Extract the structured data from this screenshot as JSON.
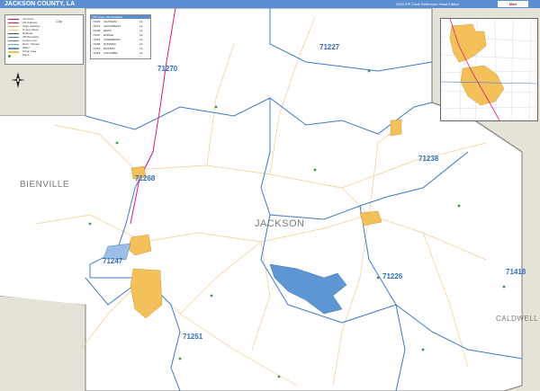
{
  "header": {
    "title": "JACKSON COUNTY, LA",
    "subtitle": "2020 ZIP Code Reference Head Edition",
    "brand": "Mart"
  },
  "counties": {
    "center": "JACKSON",
    "west": "BIENVILLE",
    "southeast": "CALDWELL"
  },
  "zips": {
    "z71227": "71227",
    "z71270": "71270",
    "z71238": "71238",
    "z71268": "71268",
    "z71247": "71247",
    "z71226": "71226",
    "z71251": "71251",
    "z71418": "71418"
  },
  "legend": {
    "items": [
      "Interstate",
      "US Highway",
      "State Highway",
      "County Road",
      "Railroad",
      "ZIP Boundary",
      "County Line",
      "River / Stream",
      "Water",
      "Urban Area",
      "Place"
    ],
    "city_label": "City"
  },
  "zip_table": {
    "header": "ZIP Code / Municipalities",
    "rows": [
      {
        "zip": "71226",
        "name": "CHATHAM",
        "county": "LA"
      },
      {
        "zip": "71227",
        "name": "CHOUDRANT",
        "county": "LA"
      },
      {
        "zip": "71238",
        "name": "EROS",
        "county": "LA"
      },
      {
        "zip": "71247",
        "name": "HODGE",
        "county": "LA"
      },
      {
        "zip": "71251",
        "name": "JONESBORO",
        "county": "LA"
      },
      {
        "zip": "71268",
        "name": "QUITMAN",
        "county": "LA"
      },
      {
        "zip": "71270",
        "name": "RUSTON",
        "county": "LA"
      },
      {
        "zip": "71418",
        "name": "COLUMBIA",
        "county": "LA"
      }
    ]
  },
  "colors": {
    "title_bar": "#5b8fd1",
    "zip_boundary": "#3e79c8",
    "county_fill": "#ffffff",
    "outside_fill": "#e5e2d8",
    "urban": "#f4c059",
    "water": "#5d96d3",
    "highway": "#e0197d",
    "roads": "#f2c98e"
  }
}
